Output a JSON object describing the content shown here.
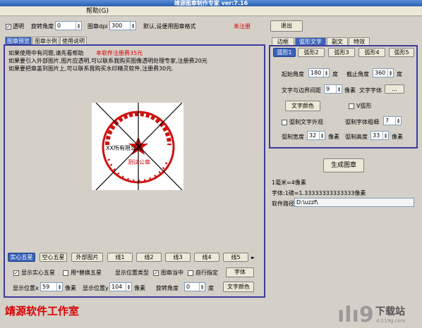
{
  "window": {
    "title": "靖源图章制作专家 ver:7.16"
  },
  "menu": {
    "item": "帮助(G)"
  },
  "toolbar": {
    "transparent_label": "透明",
    "rotation_label": "旋转角度",
    "rotation_value": "0",
    "dpi_label": "图章dpi",
    "dpi_value": "300",
    "default_text": "默认,设便用图章格式",
    "unregistered": "未注册",
    "exit_label": "退出"
  },
  "left_tabs": [
    "图章预览",
    "图章示例",
    "使用说明"
  ],
  "notes": {
    "line1": "如果使用中有问题,请先看帮助",
    "line1_price": "本软件注册费35元",
    "line2": "如果要引入外部图片,图片应透明,可以联系我购买图像透明处理专家,注册费20元",
    "line3": "如果要把章盖到图片上,可以联系我购买水印精灵软件,注册费30元."
  },
  "stamp": {
    "bottom_text": "测试公章",
    "middle_text": "XX所有限公司"
  },
  "shape_buttons": [
    "实心五星",
    "空心五星",
    "外部图片",
    "线1",
    "线2",
    "线3",
    "线4",
    "线5"
  ],
  "bottom_options": {
    "show_star": "显示实心五星",
    "use_star": "用*替换五星",
    "position_type": "显示位置类型",
    "stamp_center": "图章当中",
    "custom": "自行指定",
    "font_button": "字体",
    "x_label": "显示位置x",
    "x_value": "59",
    "x_unit": "像素",
    "y_label": "显示位置y",
    "y_value": "104",
    "y_unit": "像素",
    "rot_label": "旋转角度",
    "rot_value": "0",
    "rot_unit": "度",
    "color_button": "文字颜色"
  },
  "footer": {
    "studio": "靖源软件工作室"
  },
  "right_tabs": [
    "边框",
    "弧形文字",
    "副文",
    "特效"
  ],
  "sub_tabs": [
    "弧形1",
    "弧形2",
    "弧形3",
    "弧形4",
    "弧形5"
  ],
  "arc": {
    "start_label": "起始角度",
    "start_value": "180",
    "start_unit": "度",
    "end_label": "截止角度",
    "end_value": "360",
    "end_unit": "度",
    "dist_label": "文字与边界间距",
    "dist_value": "9",
    "dist_unit": "像素",
    "font_label": "文字字体",
    "font_btn": "...",
    "color_btn": "文字颜色",
    "v_arc": "V弧形",
    "outline": "弧制文字外观",
    "weight_label": "弧制字体粗细",
    "weight_value": "7",
    "width_label": "弧制宽度",
    "width_value": "32",
    "width_unit": "像素",
    "height_label": "弧制高度",
    "height_value": "33",
    "height_unit": "像素"
  },
  "generate_btn": "生成图章",
  "info": {
    "mm": "1毫米=4像素",
    "font_ratio": "字体:1磅=1.33333333333333像素",
    "path_label": "软件路径",
    "path_value": "D:\\uzzf\\"
  },
  "watermark": {
    "text": "下载站",
    "url": "d.119g.com"
  },
  "colors": {
    "accent": "#3a62b8",
    "red": "#d80000",
    "frame": "#3c3c9a"
  }
}
